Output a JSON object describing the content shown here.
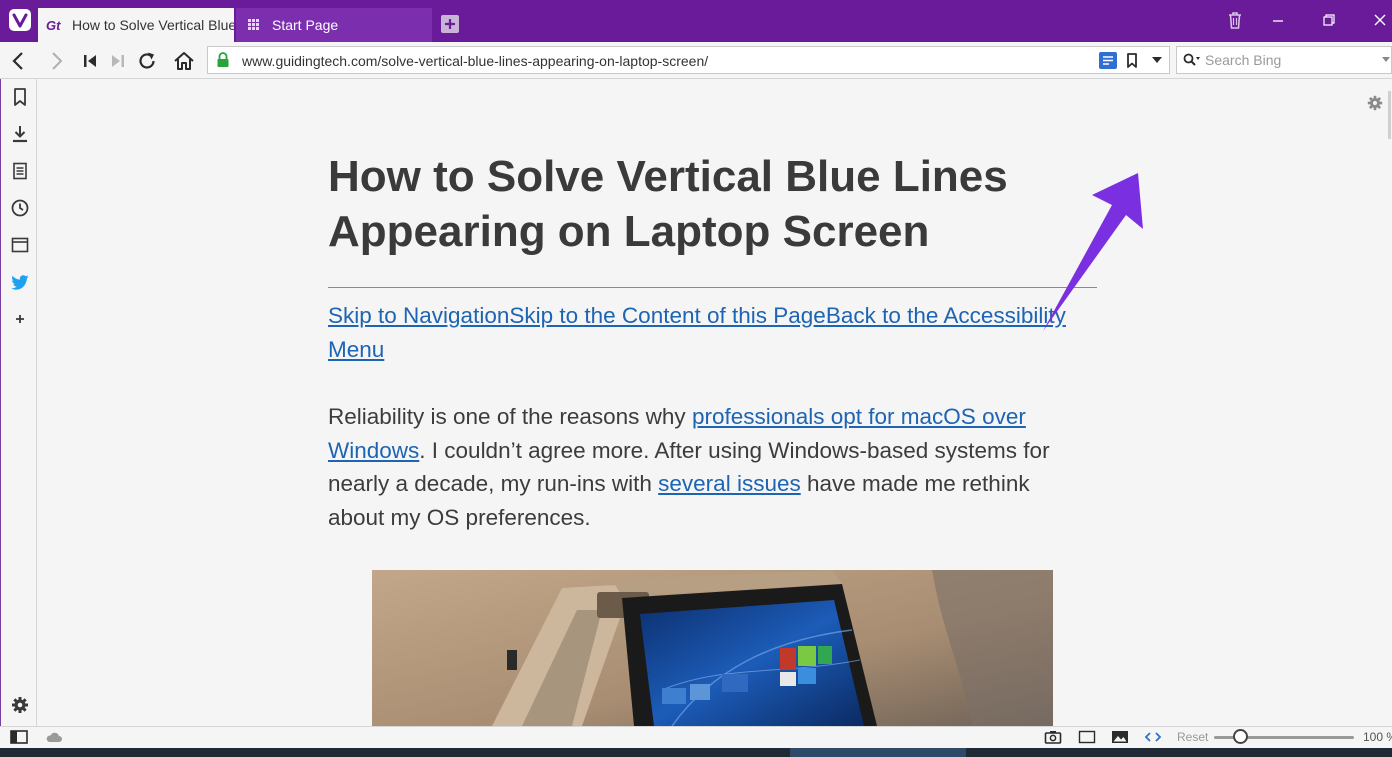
{
  "tabs": [
    {
      "title": "How to Solve Vertical Blue L",
      "active": true,
      "favicon": "guidingtech-logo"
    },
    {
      "title": "Start Page",
      "active": false,
      "favicon": "speed-dial-grid-icon"
    }
  ],
  "address_bar": {
    "url": "www.guidingtech.com/solve-vertical-blue-lines-appearing-on-laptop-screen/",
    "secure": true
  },
  "search": {
    "placeholder": "Search Bing"
  },
  "side_panel": {
    "items": [
      "bookmarks-icon",
      "downloads-icon",
      "notes-icon",
      "history-icon",
      "window-panel-icon",
      "twitter-icon",
      "add-panel-icon"
    ]
  },
  "article": {
    "title": "How to Solve Vertical Blue Lines Appearing on Laptop Screen",
    "skip_links": [
      "Skip to Navigation",
      "Skip to the Content of this Page",
      "Back to the Accessibility Menu"
    ],
    "intro": {
      "part1": "Reliability is one of the reasons why ",
      "link1": "professionals opt for macOS over Windows",
      "part2": ". I couldn’t agree more. After using Windows-based systems for nearly a decade, my run-ins with ",
      "link2": "several issues",
      "part3": " have made me rethink about my OS preferences."
    },
    "hero_image": "laptop-in-tent-mode-photo"
  },
  "status_bar": {
    "reset_label": "Reset",
    "zoom_value": "100 %",
    "zoom_level_percent": 100
  },
  "colors": {
    "accent": "#6a1b9a",
    "link": "#1d64b3",
    "annotation_arrow": "#7a2fe0"
  }
}
